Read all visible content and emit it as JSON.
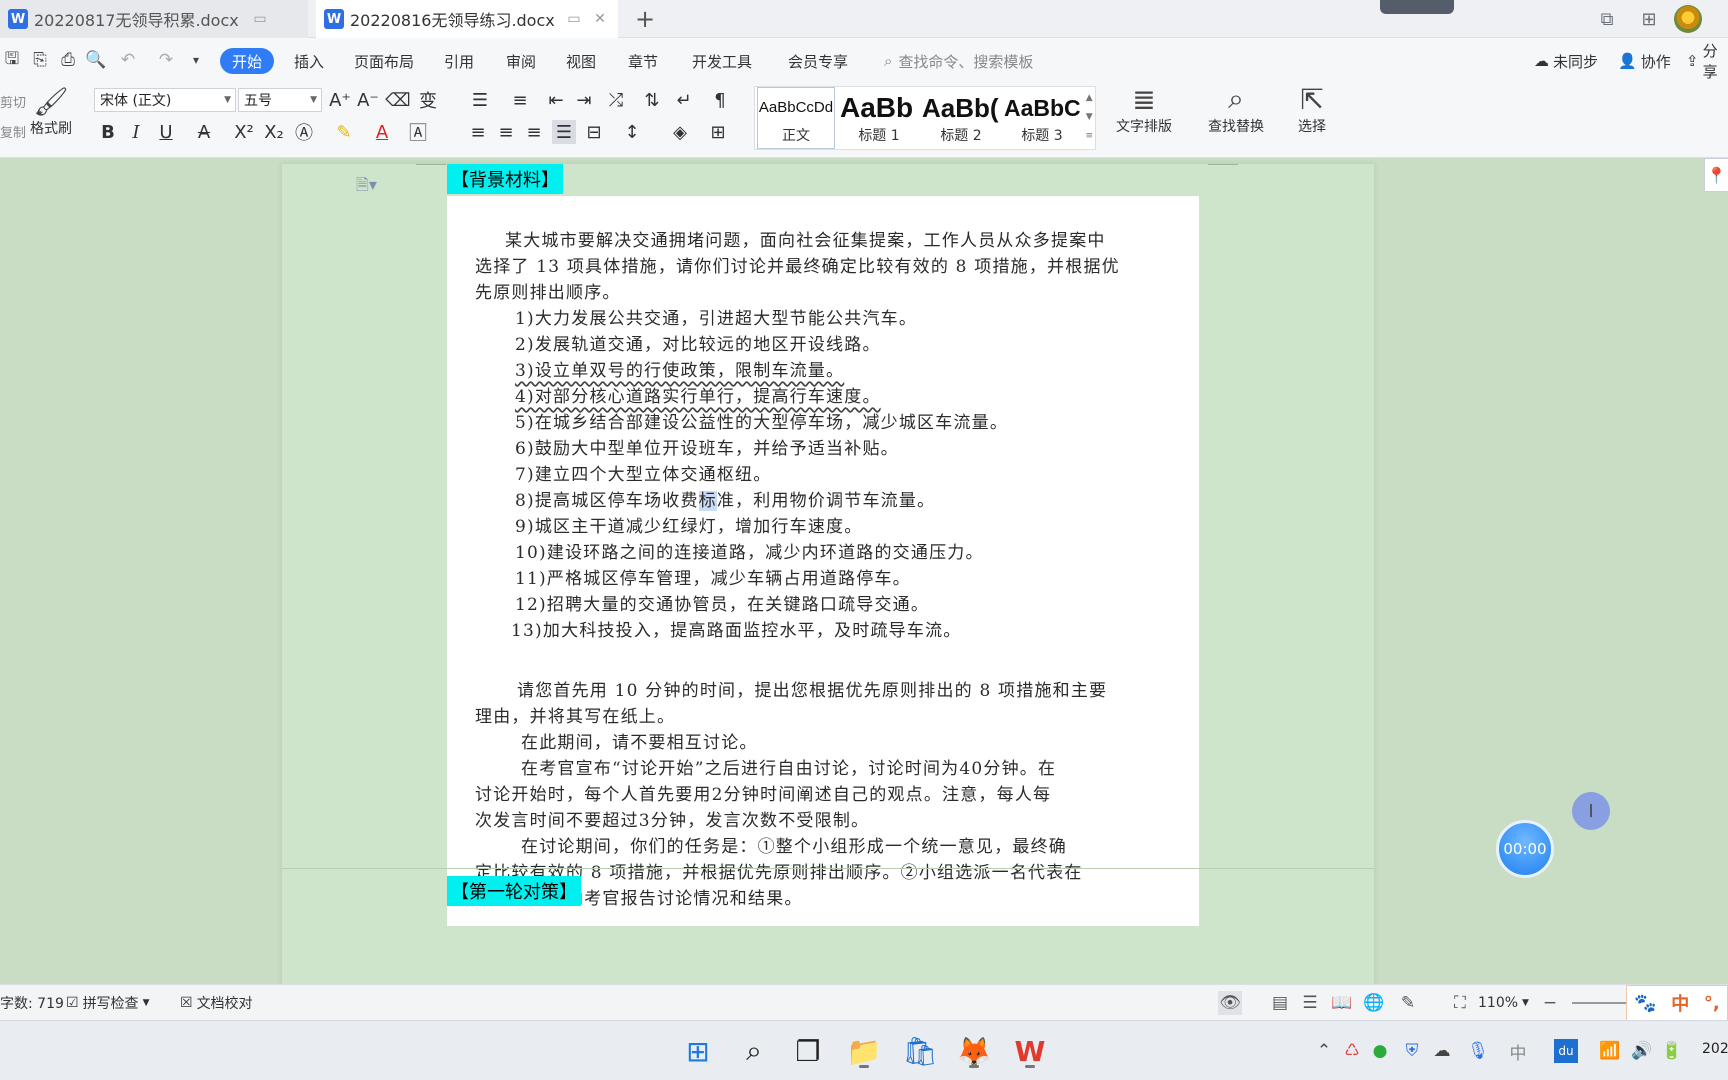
{
  "tabs": [
    {
      "title": "20220817无领导积累.docx",
      "icon": "W"
    },
    {
      "title": "20220816无领导练习.docx",
      "icon": "W"
    }
  ],
  "menu": {
    "items": [
      "开始",
      "插入",
      "页面布局",
      "引用",
      "审阅",
      "视图",
      "章节",
      "开发工具",
      "会员专享"
    ],
    "search_placeholder": "查找命令、搜索模板",
    "sync": "未同步",
    "collab": "协作",
    "share": "分享"
  },
  "ribbon": {
    "cut": "剪切",
    "copy": "复制",
    "format_painter": "格式刷",
    "font_name": "宋体 (正文)",
    "font_size": "五号",
    "styles": [
      {
        "sample": "AaBbCcDd",
        "name": "正文"
      },
      {
        "sample": "AaBb",
        "name": "标题 1"
      },
      {
        "sample": "AaBb(",
        "name": "标题 2"
      },
      {
        "sample": "AaBbC(",
        "name": "标题 3"
      }
    ],
    "text_layout": "文字排版",
    "find_replace": "查找替换",
    "select": "选择"
  },
  "document": {
    "tag_background": "【背景材料】",
    "tag_round1": "【第一轮对策】",
    "intro": [
      "某大城市要解决交通拥堵问题，面向社会征集提案，工作人员从众多提案中",
      "选择了 13 项具体措施，请你们讨论并最终确定比较有效的 8 项措施，并根据优",
      "先原则排出顺序。"
    ],
    "measures": [
      "1)大力发展公共交通，引进超大型节能公共汽车。",
      "2)发展轨道交通，对比较远的地区开设线路。",
      "3)设立单双号的行使政策，限制车流量。",
      "4)对部分核心道路实行单行，提高行车速度。",
      "5)在城乡结合部建设公益性的大型停车场，减少城区车流量。",
      "6)鼓励大中型单位开设班车，并给予适当补贴。",
      "7)建立四个大型立体交通枢纽。",
      "8)提高城区停车场收费",
      "标",
      "准，利用物价调节车流量。",
      "9)城区主干道减少红绿灯，增加行车速度。",
      "10)建设环路之间的连接道路，减少内环道路的交通压力。",
      "11)严格城区停车管理，减少车辆占用道路停车。",
      "12)招聘大量的交通协管员，在关键路口疏导交通。",
      "13)加大科技投入，提高路面监控水平，及时疏导车流。"
    ],
    "instructions": [
      "请您首先用 10 分钟的时间，提出您根据优先原则排出的 8 项措施和主要",
      "理由，并将其写在纸上。",
      "在此期间，请不要相互讨论。",
      "在考官宣布“讨论开始”之后进行自由讨论，讨论时间为40分钟。在",
      "讨论开始时，每个人首先要用2分钟时间阐述自己的观点。注意，每人每",
      "次发言时间不要超过3分钟，发言次数不受限制。",
      "在讨论期间，你们的任务是：①整个小组形成一个统一意见，最终确",
      "定比较有效的 8 项措施，并根据优先原则排出顺序。②小组选派一名代表在",
      "讨论结束后向考官报告讨论情况和结果。"
    ]
  },
  "timer": "00:00",
  "status": {
    "word_count": "字数: 719",
    "spell_check": "拼写检查",
    "doc_proof": "文档校对",
    "zoom": "110%",
    "ime_label": "中"
  },
  "clock": "202",
  "colors": {
    "accent": "#2f7cf6",
    "tag_bg": "#00f0f0",
    "page_bg": "#cfe5cb"
  }
}
